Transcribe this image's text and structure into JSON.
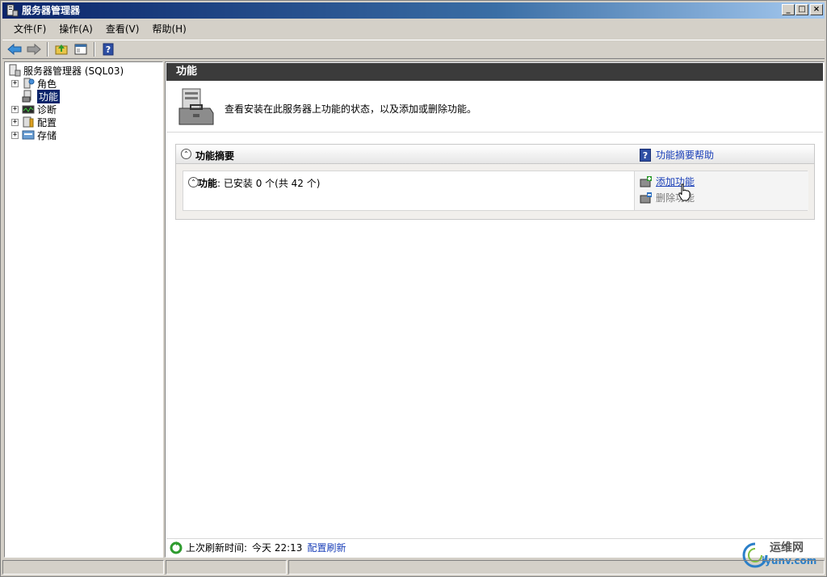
{
  "window": {
    "title": "服务器管理器"
  },
  "window_buttons": {
    "minimize": "_",
    "maximize": "□",
    "close": "×"
  },
  "menu": [
    "文件(F)",
    "操作(A)",
    "查看(V)",
    "帮助(H)"
  ],
  "tree": {
    "root": "服务器管理器 (SQL03)",
    "items": [
      {
        "label": "角色",
        "expander": "+"
      },
      {
        "label": "功能",
        "expander": ""
      },
      {
        "label": "诊断",
        "expander": "+"
      },
      {
        "label": "配置",
        "expander": "+"
      },
      {
        "label": "存储",
        "expander": "+"
      }
    ]
  },
  "content": {
    "header": "功能",
    "intro": "查看安装在此服务器上功能的状态，以及添加或删除功能。",
    "summary": {
      "title": "功能摘要",
      "help_link": "功能摘要帮助",
      "help_icon_char": "?",
      "collapse_char": "⌃",
      "features_label": "功能",
      "features_status": ": 已安装 0 个(共 42 个)",
      "actions": {
        "add": "添加功能",
        "remove": "删除功能"
      }
    },
    "status": {
      "last_refresh_label": "上次刷新时间:",
      "last_refresh_value": "今天 22:13",
      "configure_refresh": "配置刷新"
    }
  },
  "watermark": {
    "cn": "运维网",
    "en": "iyunv.com"
  },
  "colors": {
    "header_bg": "#3b3b3b",
    "link": "#1a3fb8",
    "title_bar": "#0a246a"
  }
}
